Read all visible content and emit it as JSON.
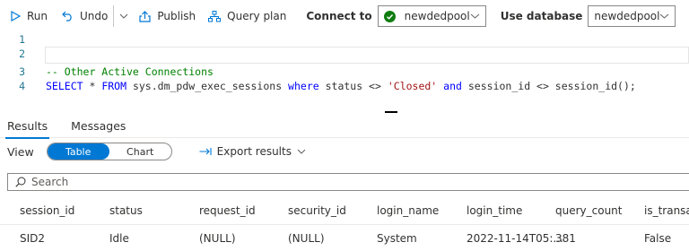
{
  "toolbar": {
    "run": "Run",
    "undo": "Undo",
    "publish": "Publish",
    "query_plan": "Query plan",
    "connect_to_label": "Connect to",
    "connect_to_value": "newdedpool",
    "use_database_label": "Use database",
    "use_database_value": "newdedpool"
  },
  "editor": {
    "line_numbers": [
      "1",
      "2",
      "3",
      "4"
    ],
    "line3_comment": "-- Other Active Connections",
    "line4": {
      "kw1": "SELECT",
      "t1": " * ",
      "kw2": "FROM",
      "t2": " sys.dm_pdw_exec_sessions ",
      "kw3": "where",
      "t3": " status <> ",
      "str1": "'Closed'",
      "t4": " ",
      "kw4": "and",
      "t5": " session_id <> session_id();"
    }
  },
  "results": {
    "tabs": [
      "Results",
      "Messages"
    ],
    "view_label": "View",
    "view_options": [
      "Table",
      "Chart"
    ],
    "export": "Export results",
    "search_placeholder": "Search",
    "columns": [
      "session_id",
      "status",
      "request_id",
      "security_id",
      "login_name",
      "login_time",
      "query_count",
      "is_transact"
    ],
    "rows": [
      [
        "SID2",
        "Idle",
        "(NULL)",
        "(NULL)",
        "System",
        "2022-11-14T05:...",
        "381",
        "False"
      ]
    ]
  },
  "colors": {
    "accent": "#0078d4",
    "success": "#107c10",
    "keyword": "#0000ff",
    "string": "#a31515",
    "comment": "#008000",
    "line_number": "#237893"
  }
}
